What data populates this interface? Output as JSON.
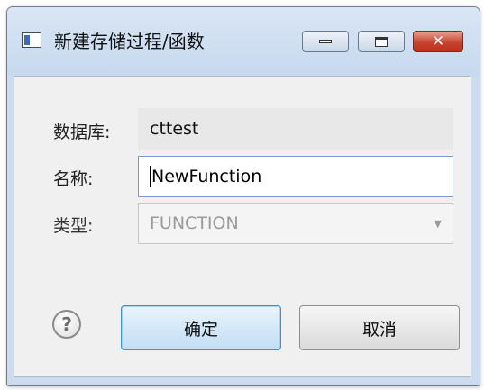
{
  "window": {
    "title": "新建存储过程/函数",
    "controls": {
      "minimize": "minimize",
      "maximize": "maximize",
      "close": "close"
    }
  },
  "form": {
    "database": {
      "label": "数据库:",
      "value": "cttest"
    },
    "name": {
      "label": "名称:",
      "value": "NewFunction"
    },
    "type": {
      "label": "类型:",
      "selected": "FUNCTION"
    }
  },
  "help": {
    "glyph": "?"
  },
  "buttons": {
    "ok": "确定",
    "cancel": "取消"
  },
  "colors": {
    "title_bar": "#c7d9ee",
    "close_button": "#c8432f",
    "ok_border": "#3d8ed3",
    "disabled_text": "#9a9a9a"
  }
}
